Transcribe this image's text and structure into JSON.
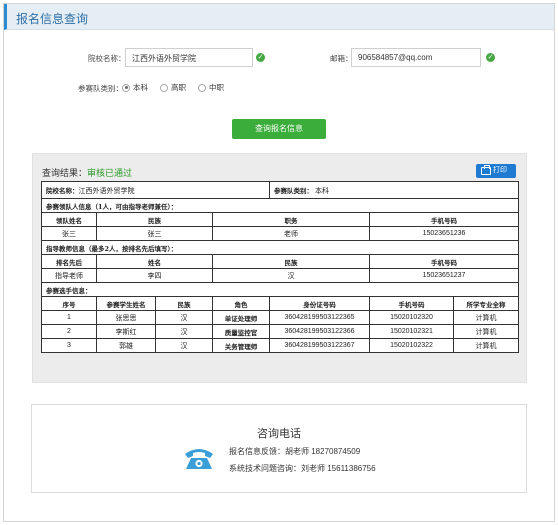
{
  "header": {
    "title": "报名信息查询"
  },
  "form": {
    "school_label": "院校名称：",
    "school_value": "江西外语外贸学院",
    "email_label": "邮箱：",
    "email_value": "906584857@qq.com",
    "team_type_label": "参赛队类别：",
    "team_types": [
      {
        "label": "本科",
        "checked": true
      },
      {
        "label": "高职",
        "checked": false
      },
      {
        "label": "中职",
        "checked": false
      }
    ],
    "query_button": "查询报名信息"
  },
  "result": {
    "prefix": "查询结果：",
    "status": "审核已通过",
    "print_button": "打印",
    "school_label": "院校名称：",
    "school_value": "江西外语外贸学院",
    "team_type_label": "参赛队类别：",
    "team_type_value": "本科",
    "leader_section": "参赛领队人信息（1人，可由指导老师兼任）：",
    "leader_headers": [
      "领队姓名",
      "民族",
      "职务",
      "手机号码"
    ],
    "leader_row": [
      "张三",
      "张三",
      "老师",
      "15023651236"
    ],
    "teacher_section": "指导教师信息（最多2人，按排名先后填写）：",
    "teacher_headers": [
      "排名先后",
      "姓名",
      "民族",
      "手机号码"
    ],
    "teacher_row": [
      "指导老师",
      "李四",
      "汉",
      "15023651237"
    ],
    "student_section": "参赛选手信息：",
    "student_headers": [
      "序号",
      "参赛学生姓名",
      "民族",
      "角色",
      "身份证号码",
      "手机号码",
      "所学专业全称"
    ],
    "students": [
      [
        "1",
        "张思思",
        "汉",
        "单证处理师",
        "360428199503122365",
        "15020102320",
        "计算机"
      ],
      [
        "2",
        "李斯红",
        "汉",
        "质量监控官",
        "360428199503122366",
        "15020102321",
        "计算机"
      ],
      [
        "3",
        "郭雄",
        "汉",
        "关务管理师",
        "360428199503122367",
        "15020102322",
        "计算机"
      ]
    ]
  },
  "contact": {
    "title": "咨询电话",
    "line1": "报名信息反馈：胡老师 18270874509",
    "line2": "系统技术问题咨询：刘老师 15611386756"
  }
}
